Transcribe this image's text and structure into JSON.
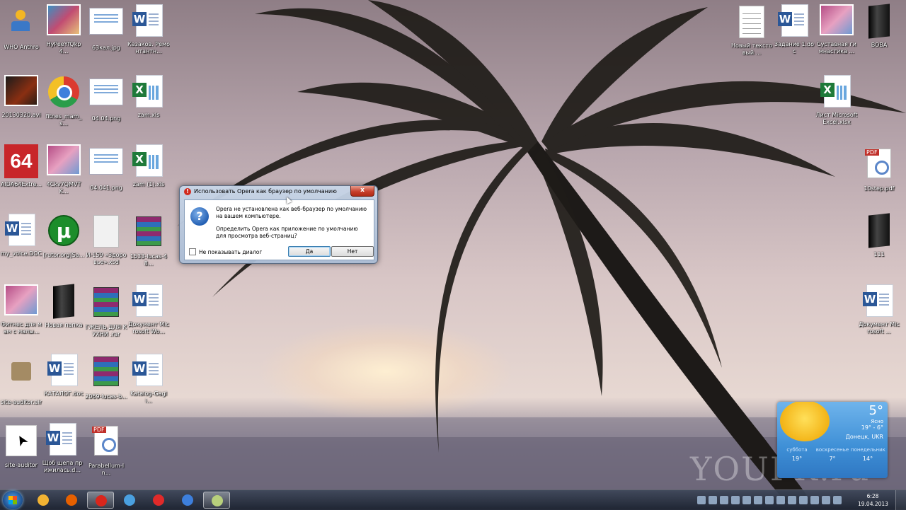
{
  "desktop": {
    "watermark": "YOUPK.ru",
    "icons": [
      {
        "label": "WHO Anthro",
        "icon": "who-anthro-icon"
      },
      {
        "label": "HyPeeYfQkp4...",
        "icon": "photo-icon"
      },
      {
        "label": "63кал.jpg",
        "icon": "webpage-image-icon"
      },
      {
        "label": "Казаков. Ремонтантн...",
        "icon": "word-doc-icon"
      },
      {
        "label": "20130320.avi",
        "icon": "video-icon"
      },
      {
        "label": "fitnes_mam_s...",
        "icon": "chrome-icon"
      },
      {
        "label": "04.04.png",
        "icon": "webpage-image-icon"
      },
      {
        "label": "zam.xls",
        "icon": "excel-icon"
      },
      {
        "label": "AIDA64Extre...",
        "icon": "aida64-icon"
      },
      {
        "label": "4Ckv7QMVTK...",
        "icon": "photo-icon"
      },
      {
        "label": "04.041.png",
        "icon": "webpage-image-icon"
      },
      {
        "label": "zam (1).xls",
        "icon": "excel-icon"
      },
      {
        "label": "my_voice.DOC",
        "icon": "word-doc-icon"
      },
      {
        "label": "[rutor.org]Sa...",
        "icon": "utorrent-icon"
      },
      {
        "label": "И-159 «Здоровье».xsd",
        "icon": "blank-file-icon"
      },
      {
        "label": "1533-lucas-48...",
        "icon": "winrar-icon"
      },
      {
        "label": "Фитнес для мам с малы...",
        "icon": "photo-icon"
      },
      {
        "label": "Новая папка",
        "icon": "dark-folder-icon"
      },
      {
        "label": "ГЖЕЛЬ ДЛЯ КУХНИ .rar",
        "icon": "winrar-icon"
      },
      {
        "label": "Документ Microsoft Wo...",
        "icon": "word-doc-icon"
      },
      {
        "label": "site-auditor.air",
        "icon": "air-archive-icon"
      },
      {
        "label": "КАТАЛОГ.doc",
        "icon": "word-doc-icon"
      },
      {
        "label": "2069-lucas-b...",
        "icon": "winrar-icon"
      },
      {
        "label": "Katalog-Gagli...",
        "icon": "word-doc-icon"
      },
      {
        "label": "site-auditor",
        "icon": "cursor-app-icon"
      },
      {
        "label": "Щоб щепа прижилась.d...",
        "icon": "word-doc-icon"
      },
      {
        "label": "Parabellum-In...",
        "icon": "pdf-icon"
      }
    ],
    "right_icons": [
      {
        "label": "Новый текстовый ...",
        "icon": "text-file-icon"
      },
      {
        "label": "Задание 1.doc",
        "icon": "word-doc-icon"
      },
      {
        "label": "Суставная гимнастика ...",
        "icon": "photo-icon"
      },
      {
        "label": "BOBA",
        "icon": "dark-folder-icon"
      },
      {
        "label": "Лист Microsoft Excel.xlsx",
        "icon": "excel-icon"
      },
      {
        "label": "10step.pdf",
        "icon": "pdf-icon"
      },
      {
        "label": "111",
        "icon": "dark-folder-icon"
      },
      {
        "label": "Документ Microsoft ...",
        "icon": "word-doc-icon"
      }
    ]
  },
  "dialog": {
    "title": "Использовать Opera как браузер по умолчанию",
    "close_label": "x",
    "message_1": "Opera не установлена как веб-браузер по умолчанию на вашем компьютере.",
    "message_2": "Определить Opera как приложение по умолчанию для просмотра веб-страниц?",
    "checkbox_label": "Не показывать диалог",
    "yes_label": "Да",
    "no_label": "Нет"
  },
  "weather": {
    "temperature": "5°",
    "condition": "Ясно",
    "range": "19° - 6°",
    "location": "Донецк, UKR",
    "forecast": [
      {
        "day": "суббота",
        "temp": "19°"
      },
      {
        "day": "воскресенье",
        "temp": "7°"
      },
      {
        "day": "понедельник",
        "temp": "14°"
      }
    ]
  },
  "taskbar": {
    "clock_time": "6:28",
    "clock_date": "19.04.2013",
    "apps": [
      {
        "name": "explorer",
        "color": "#f2b333"
      },
      {
        "name": "firefox",
        "color": "#e66000"
      },
      {
        "name": "opera",
        "color": "#d9261c"
      },
      {
        "name": "weather",
        "color": "#4aa0e0"
      },
      {
        "name": "yandex",
        "color": "#e02a2a"
      },
      {
        "name": "chrome",
        "color": "#3d7fdc"
      },
      {
        "name": "file",
        "color": "#b8d07c"
      }
    ]
  }
}
